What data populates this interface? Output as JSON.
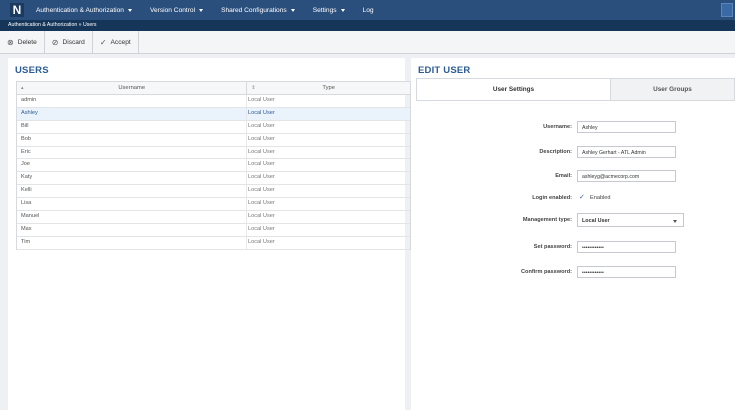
{
  "nav": {
    "logo": "N",
    "items": [
      {
        "label": "Authentication & Authorization",
        "caret": true
      },
      {
        "label": "Version Control",
        "caret": true
      },
      {
        "label": "Shared Configurations",
        "caret": true
      },
      {
        "label": "Settings",
        "caret": true
      },
      {
        "label": "Log",
        "caret": false
      }
    ]
  },
  "breadcrumb": "Authentication & Authorization » Users",
  "toolbar": {
    "delete_label": "Delete",
    "discard_label": "Discard",
    "accept_label": "Accept"
  },
  "users": {
    "title": "USERS",
    "columns": {
      "username": "Username",
      "type": "Type"
    },
    "rows": [
      {
        "username": "admin",
        "type": "Local User"
      },
      {
        "username": "Ashley",
        "type": "Local User"
      },
      {
        "username": "Bill",
        "type": "Local User"
      },
      {
        "username": "Bob",
        "type": "Local User"
      },
      {
        "username": "Eric",
        "type": "Local User"
      },
      {
        "username": "Joe",
        "type": "Local User"
      },
      {
        "username": "Katy",
        "type": "Local User"
      },
      {
        "username": "Kelli",
        "type": "Local User"
      },
      {
        "username": "Lisa",
        "type": "Local User"
      },
      {
        "username": "Manuel",
        "type": "Local User"
      },
      {
        "username": "Max",
        "type": "Local User"
      },
      {
        "username": "Tim",
        "type": "Local User"
      }
    ],
    "selected_index": 1
  },
  "edit_user": {
    "title": "EDIT USER",
    "tabs": {
      "settings": "User Settings",
      "groups": "User Groups"
    },
    "form": {
      "username_label": "Username:",
      "username_value": "Ashley",
      "description_label": "Description:",
      "description_value": "Ashley Gerhart - ATL Admin",
      "email_label": "Email:",
      "email_value": "ashleyg@acmecorp.com",
      "login_label": "Login enabled:",
      "login_checked": true,
      "login_value": "Enabled",
      "mgmt_label": "Management type:",
      "mgmt_value": "Local User",
      "setpw_label": "Set password:",
      "setpw_value": "••••••••••••",
      "confirmpw_label": "Confirm password:",
      "confirmpw_value": "••••••••••••"
    }
  },
  "colors": {
    "topbar": "#2b4f7c",
    "breadcrumb": "#163659",
    "accent": "#2c5c96",
    "selected_row": "#eaf2fb"
  }
}
